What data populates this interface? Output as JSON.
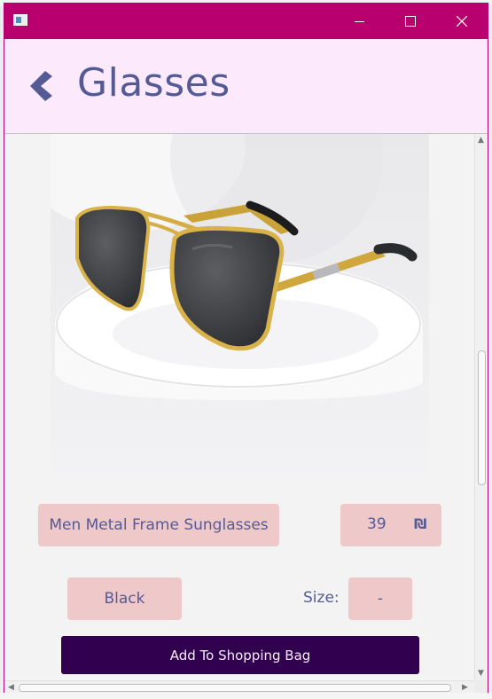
{
  "window": {
    "title_bar_color": "#b8006f",
    "app_icon": "java-window-icon",
    "controls": {
      "minimize": "minimize-icon",
      "maximize": "maximize-icon",
      "close": "close-icon"
    }
  },
  "header": {
    "title": "Glasses",
    "back_icon": "chevron-left-icon",
    "background": "#fce9fb",
    "title_color": "#545a96"
  },
  "product": {
    "image": "gold-metal-frame-sunglasses-photo",
    "name": "Men Metal Frame Sunglasses",
    "price": "39",
    "currency_symbol": "₪",
    "color": "Black",
    "size_label": "Size:",
    "size_value": "-",
    "pill_color": "#efc9c9"
  },
  "actions": {
    "add_to_bag_label": "Add To Shopping Bag",
    "add_to_bag_color": "#31004f"
  }
}
